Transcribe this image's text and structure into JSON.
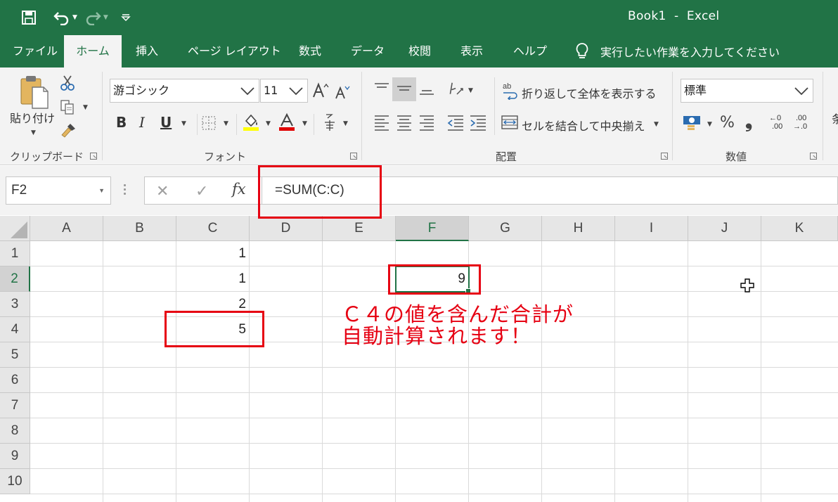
{
  "app": {
    "title": "Book1  -  Excel"
  },
  "tabs": [
    {
      "label": "ファイル",
      "active": false
    },
    {
      "label": "ホーム",
      "active": true
    },
    {
      "label": "挿入",
      "active": false
    },
    {
      "label": "ページ レイアウト",
      "active": false
    },
    {
      "label": "数式",
      "active": false
    },
    {
      "label": "データ",
      "active": false
    },
    {
      "label": "校閲",
      "active": false
    },
    {
      "label": "表示",
      "active": false
    },
    {
      "label": "ヘルプ",
      "active": false
    }
  ],
  "tell_me": "実行したい作業を入力してください",
  "ribbon": {
    "clipboard": {
      "paste_label": "貼り付け",
      "group_label": "クリップボード"
    },
    "font": {
      "font_name": "游ゴシック",
      "font_size": "11",
      "bold": "B",
      "italic": "I",
      "underline": "U",
      "group_label": "フォント"
    },
    "alignment": {
      "wrap_text": "折り返して全体を表示する",
      "merge_center": "セルを結合して中央揃え",
      "group_label": "配置"
    },
    "number": {
      "format": "標準",
      "percent": "%",
      "comma": "❟",
      "inc_decimal_top": "←0",
      "inc_decimal_bottom": ".00",
      "dec_decimal_top": ".00",
      "dec_decimal_bottom": "→.0",
      "group_label": "数値"
    },
    "next_group_char": "条"
  },
  "formula_bar": {
    "name_box": "F2",
    "formula": "=SUM(C:C)",
    "cancel_symbol": "✕",
    "enter_symbol": "✓",
    "fx_label": "fx"
  },
  "grid": {
    "columns": [
      "A",
      "B",
      "C",
      "D",
      "E",
      "F",
      "G",
      "H",
      "I",
      "J",
      "K"
    ],
    "rows": [
      "1",
      "2",
      "3",
      "4",
      "5",
      "6",
      "7",
      "8",
      "9",
      "10"
    ],
    "selected_column": "F",
    "selected_row": "2",
    "cells": {
      "C1": "1",
      "C2": "1",
      "C3": "2",
      "C4": "5",
      "F2": "9"
    }
  },
  "annotation": {
    "line1": "Ｃ４の値を含んだ合計が",
    "line2": "自動計算されます！",
    "color": "#e60012"
  },
  "colors": {
    "excel_green": "#217346",
    "annotation_red": "#e60012"
  }
}
